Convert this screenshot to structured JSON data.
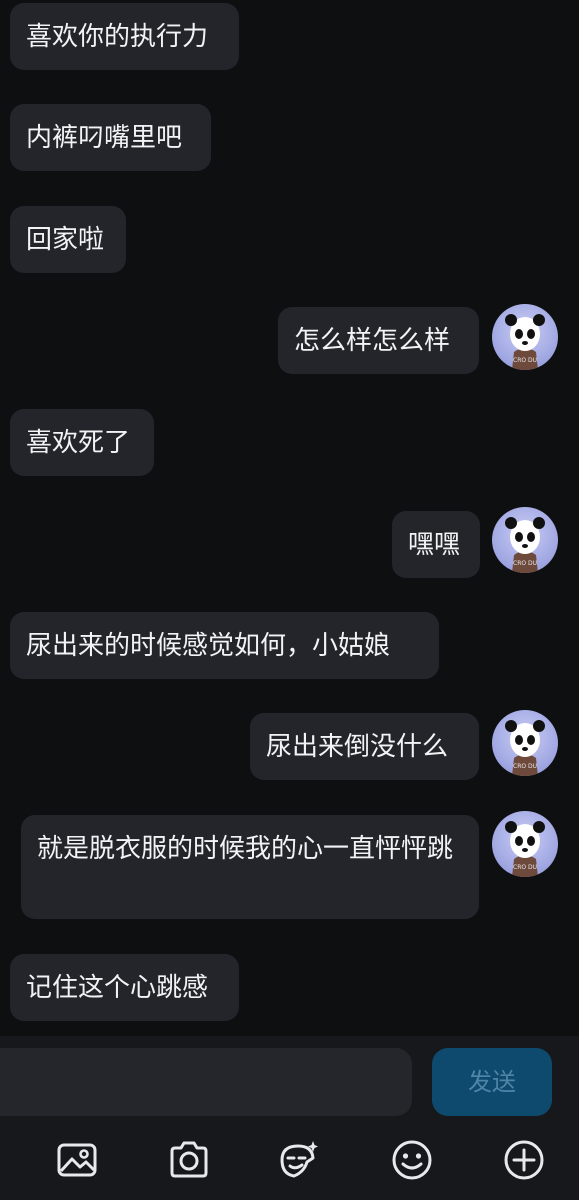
{
  "messages": [
    {
      "side": "left",
      "text": "喜欢你的执行力"
    },
    {
      "side": "left",
      "text": "内裤叼嘴里吧"
    },
    {
      "side": "left",
      "text": "回家啦"
    },
    {
      "side": "right",
      "text": "怎么样怎么样"
    },
    {
      "side": "left",
      "text": "喜欢死了"
    },
    {
      "side": "right",
      "text": "嘿嘿"
    },
    {
      "side": "left",
      "text": "尿出来的时候感觉如何，小姑娘"
    },
    {
      "side": "right",
      "text": "尿出来倒没什么"
    },
    {
      "side": "right",
      "text": "就是脱衣服的时候我的心一直怦怦跳"
    },
    {
      "side": "left",
      "text": "记住这个心跳感"
    }
  ],
  "avatar": {
    "caption": "CRO DU",
    "icon": "panda-mask-avatar"
  },
  "composer": {
    "input_value": "",
    "send_label": "发送"
  },
  "toolbar": {
    "icons": [
      "image-icon",
      "camera-icon",
      "sticker-icon",
      "emoji-icon",
      "add-icon"
    ]
  },
  "colors": {
    "background": "#0e0f11",
    "bubble": "#23252b",
    "send_button": "#0d4a6e",
    "send_text": "#4f84a6"
  }
}
